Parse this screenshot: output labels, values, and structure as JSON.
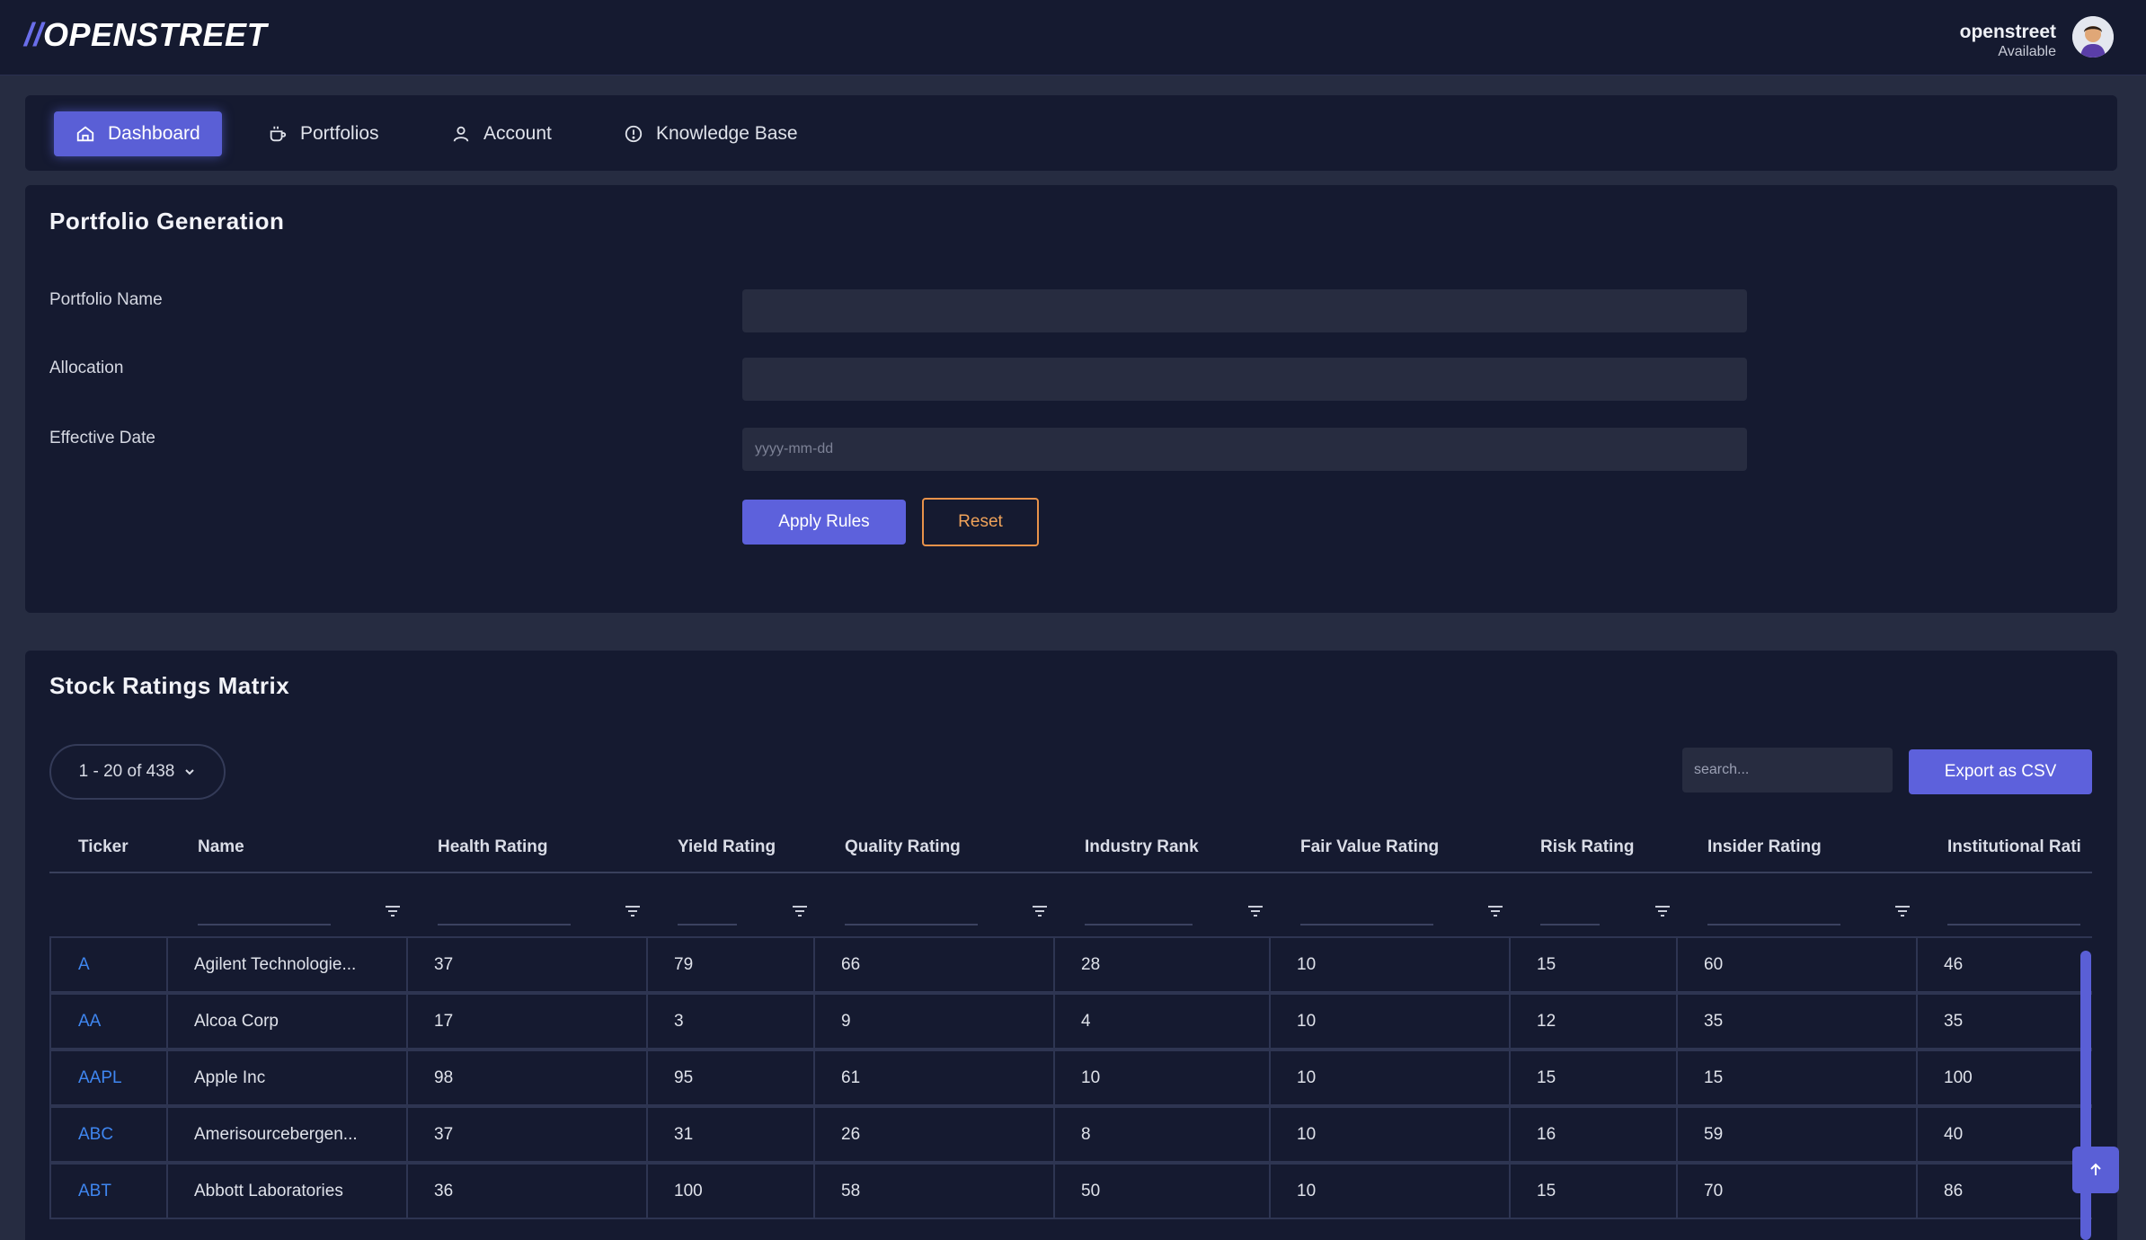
{
  "header": {
    "logo_slash": "//",
    "logo_text": "OPENSTREET",
    "user_name": "openstreet",
    "user_status": "Available"
  },
  "nav": {
    "items": [
      {
        "label": "Dashboard",
        "icon": "home-icon",
        "active": true
      },
      {
        "label": "Portfolios",
        "icon": "cup-icon",
        "active": false
      },
      {
        "label": "Account",
        "icon": "user-icon",
        "active": false
      },
      {
        "label": "Knowledge Base",
        "icon": "info-circle-icon",
        "active": false
      }
    ]
  },
  "portfolio_form": {
    "title": "Portfolio Generation",
    "name_label": "Portfolio Name",
    "name_value": "",
    "allocation_label": "Allocation",
    "allocation_value": "",
    "date_label": "Effective Date",
    "date_placeholder": "yyyy-mm-dd",
    "apply_label": "Apply Rules",
    "reset_label": "Reset"
  },
  "ratings": {
    "title": "Stock Ratings Matrix",
    "pager_label": "1 - 20 of 438",
    "search_placeholder": "search...",
    "export_label": "Export as CSV",
    "columns": [
      "Ticker",
      "Name",
      "Health Rating",
      "Yield Rating",
      "Quality Rating",
      "Industry Rank",
      "Fair Value Rating",
      "Risk Rating",
      "Insider Rating",
      "Institutional Rati"
    ],
    "rows": [
      [
        "A",
        "Agilent Technologie...",
        "37",
        "79",
        "66",
        "28",
        "10",
        "15",
        "60",
        "46"
      ],
      [
        "AA",
        "Alcoa Corp",
        "17",
        "3",
        "9",
        "4",
        "10",
        "12",
        "35",
        "35"
      ],
      [
        "AAPL",
        "Apple Inc",
        "98",
        "95",
        "61",
        "10",
        "10",
        "15",
        "15",
        "100"
      ],
      [
        "ABC",
        "Amerisourcebergen...",
        "37",
        "31",
        "26",
        "8",
        "10",
        "16",
        "59",
        "40"
      ],
      [
        "ABT",
        "Abbott Laboratories",
        "36",
        "100",
        "58",
        "50",
        "10",
        "15",
        "70",
        "86"
      ]
    ]
  },
  "colors": {
    "background": "#262c41",
    "panel": "#151a30",
    "accent": "#5a5fd6",
    "reset_outline": "#e8924a",
    "ticker_link": "#3f86f0"
  }
}
